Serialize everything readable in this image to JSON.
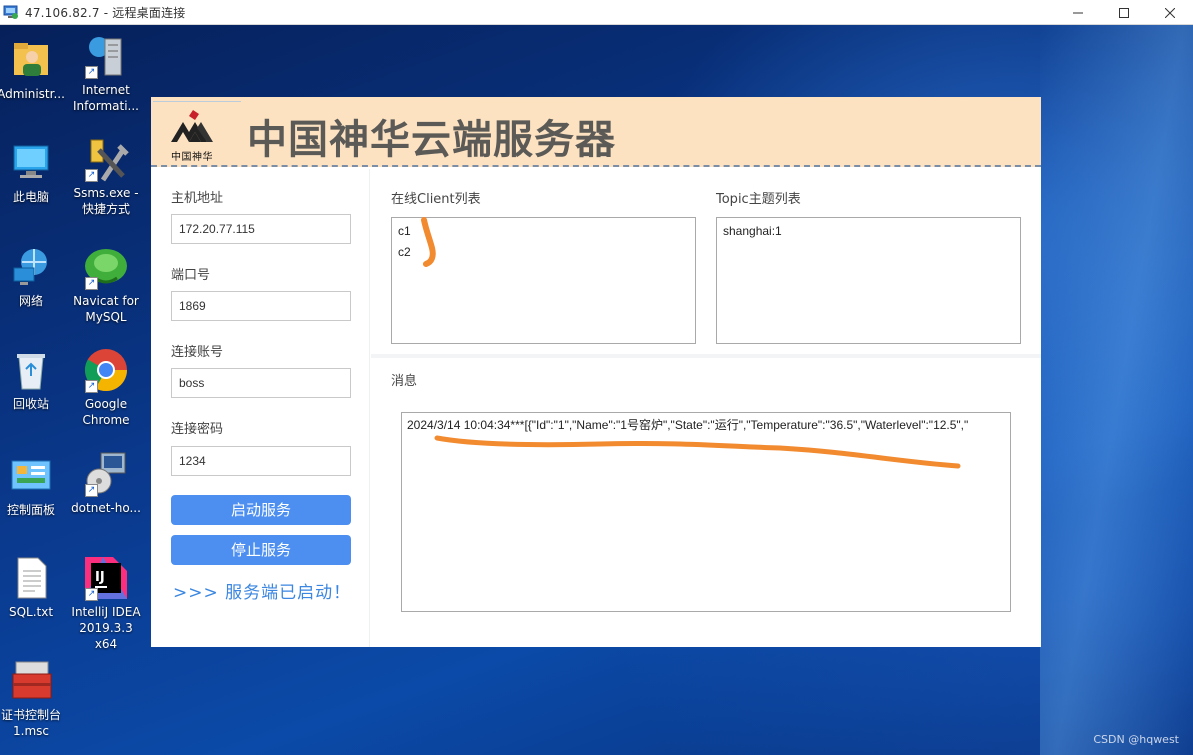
{
  "window": {
    "title": "47.106.82.7 - 远程桌面连接",
    "controls": [
      "minimize",
      "maximize",
      "close"
    ]
  },
  "desktop": {
    "icons": [
      {
        "label": "Administr...",
        "icon": "user-folder-icon"
      },
      {
        "label": "Internet Informati...",
        "icon": "iis-server-icon"
      },
      {
        "label": "此电脑",
        "icon": "computer-icon"
      },
      {
        "label": "Ssms.exe - 快捷方式",
        "icon": "ssms-tools-icon"
      },
      {
        "label": "网络",
        "icon": "network-icon"
      },
      {
        "label": "Navicat for MySQL",
        "icon": "navicat-icon"
      },
      {
        "label": "回收站",
        "icon": "recycle-bin-icon"
      },
      {
        "label": "Google Chrome",
        "icon": "chrome-icon"
      },
      {
        "label": "控制面板",
        "icon": "control-panel-icon"
      },
      {
        "label": "dotnet-ho...",
        "icon": "installer-icon"
      },
      {
        "label": "SQL.txt",
        "icon": "text-file-icon"
      },
      {
        "label": "IntelliJ IDEA 2019.3.3 x64",
        "icon": "intellij-icon"
      },
      {
        "label": "证书控制台 1.msc",
        "icon": "toolbox-icon"
      }
    ],
    "watermark": "CSDN @hqwest"
  },
  "app": {
    "logo_text": "中国神华",
    "title": "中国神华云端服务器",
    "fields": [
      {
        "label": "主机地址",
        "value": "172.20.77.115"
      },
      {
        "label": "端口号",
        "value": "1869"
      },
      {
        "label": "连接账号",
        "value": "boss"
      },
      {
        "label": "连接密码",
        "value": "1234"
      }
    ],
    "start_button": "启动服务",
    "stop_button": "停止服务",
    "status": ">>> 服务端已启动！",
    "clients_label": "在线Client列表",
    "clients": [
      "c1",
      "c2"
    ],
    "topics_label": "Topic主题列表",
    "topics": [
      "shanghai:1"
    ],
    "messages_label": "消息",
    "messages": [
      "2024/3/14 10:04:34***[{\"Id\":\"1\",\"Name\":\"1号窑炉\",\"State\":\"运行\",\"Temperature\":\"36.5\",\"Waterlevel\":\"12.5\",\""
    ],
    "colors": {
      "header_bg": "#fde2c2",
      "button": "#4d8ff0",
      "status": "#3a86e0",
      "annotation": "#f28a30"
    }
  }
}
